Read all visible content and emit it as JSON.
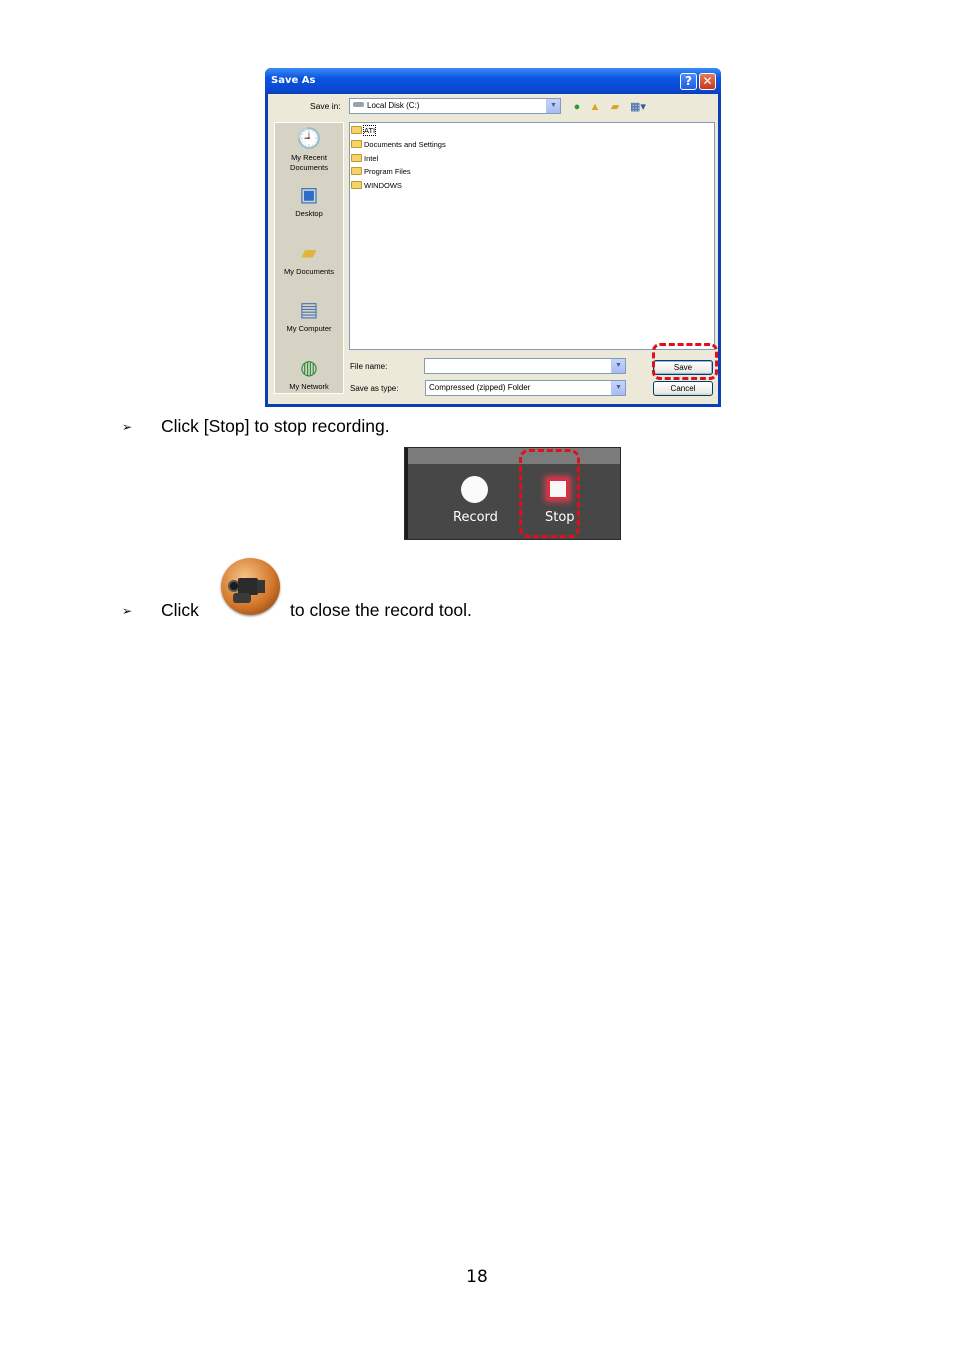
{
  "dialog": {
    "title": "Save As",
    "help_glyph": "?",
    "close_glyph": "✕",
    "save_in_label": "Save in:",
    "save_in_value": "Local Disk (C:)",
    "places": [
      "My Recent Documents",
      "Desktop",
      "My Documents",
      "My Computer",
      "My Network"
    ],
    "places_icons": [
      "recent-documents-icon",
      "desktop-icon",
      "my-documents-icon",
      "my-computer-icon",
      "my-network-icon"
    ],
    "folders": [
      "ATI",
      "Documents and Settings",
      "Intel",
      "Program Files",
      "WINDOWS"
    ],
    "file_name_label": "File name:",
    "file_name_value": "",
    "save_type_label": "Save as type:",
    "save_type_value": "Compressed (zipped) Folder",
    "save_button": "Save",
    "cancel_button": "Cancel",
    "highlight_color": "#e0101a"
  },
  "steps": [
    {
      "bullet": "➢",
      "text": "Click [Stop] to stop recording."
    },
    {
      "bullet": "➢",
      "text_before": "Click",
      "icon": "record-tool-camera-icon",
      "text_after": "to close the record tool."
    }
  ],
  "record_panel": {
    "record_label": "Record",
    "stop_label": "Stop"
  },
  "page_number": "18"
}
